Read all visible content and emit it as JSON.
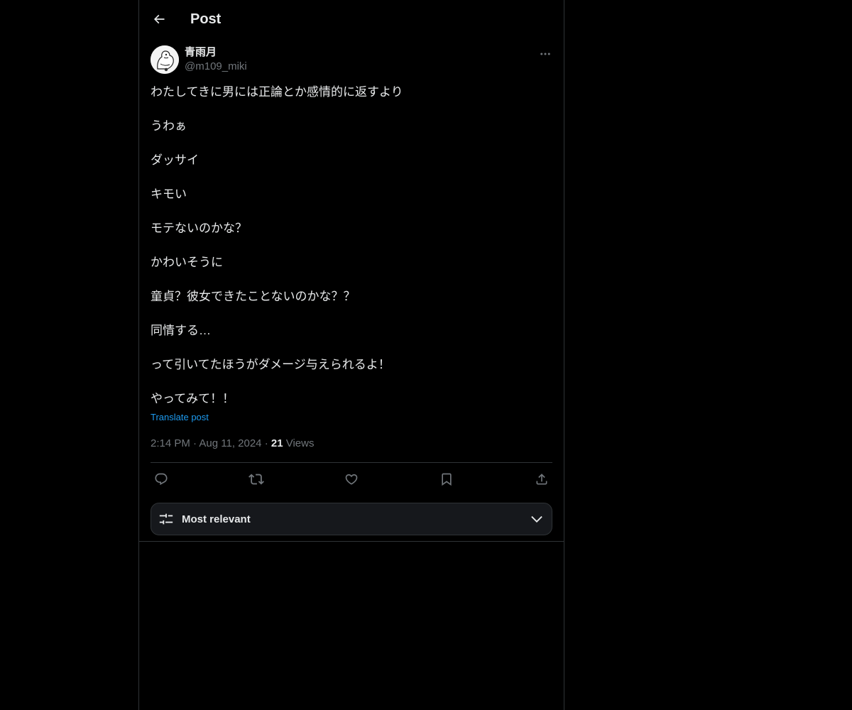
{
  "header": {
    "title": "Post",
    "back_icon": "arrow-left-icon"
  },
  "post": {
    "author": {
      "display_name": "青雨月",
      "handle": "@m109_miki",
      "avatar_icon": "avatar-illustration"
    },
    "more_icon": "more-horizontal-icon",
    "lines": [
      "わたしてきに男には正論とか感情的に返すより",
      "",
      "うわぁ",
      "",
      "ダッサイ",
      "",
      "キモい",
      "",
      "モテないのかな？",
      "",
      "かわいそうに",
      "",
      "童貞？彼女できたことないのかな？？",
      "",
      "同情する…",
      "",
      "って引いてたほうがダメージ与えられるよ！",
      "",
      "やってみて！！"
    ],
    "translate_label": "Translate post",
    "time": "2:14 PM",
    "separator": "·",
    "date": "Aug 11, 2024",
    "views_count": "21",
    "views_label": "Views"
  },
  "actions": {
    "reply_icon": "reply-icon",
    "repost_icon": "repost-icon",
    "like_icon": "heart-icon",
    "bookmark_icon": "bookmark-icon",
    "share_icon": "share-icon"
  },
  "sort": {
    "label": "Most relevant",
    "icon": "sliders-icon",
    "chevron_icon": "chevron-down-icon"
  },
  "colors": {
    "background": "#000000",
    "text_primary": "#e7e9ea",
    "text_secondary": "#71767b",
    "link": "#1d9bf0",
    "border": "#2f3336"
  }
}
